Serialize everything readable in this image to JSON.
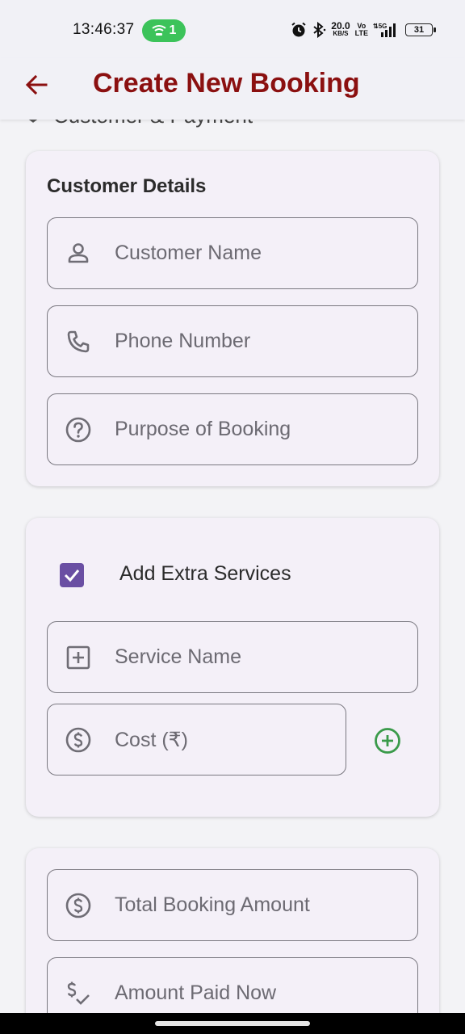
{
  "status_bar": {
    "time": "13:46:37",
    "hotspot_count": "1",
    "net_speed_value": "20.0",
    "net_speed_unit": "KB/S",
    "volte_top": "Vo",
    "volte_bottom": "LTE",
    "network": "5G",
    "battery": "31"
  },
  "app_bar": {
    "title": "Create New Booking",
    "back_icon": "arrow-left-icon",
    "title_color": "#8b1010"
  },
  "partial_section_heading": "Customer & Payment",
  "customer_card": {
    "title": "Customer Details",
    "fields": [
      {
        "icon": "person-icon",
        "placeholder": "Customer Name"
      },
      {
        "icon": "phone-icon",
        "placeholder": "Phone Number"
      },
      {
        "icon": "help-circle-icon",
        "placeholder": "Purpose of Booking"
      }
    ]
  },
  "extra_services_card": {
    "checkbox_label": "Add Extra Services",
    "checkbox_checked": true,
    "checkbox_color": "#6a4fa3",
    "service_name_placeholder": "Service Name",
    "cost_placeholder": "Cost (₹)",
    "add_icon": "add-circle-icon",
    "add_icon_color": "#3a9a4a"
  },
  "payment_card": {
    "fields": [
      {
        "icon": "dollar-circle-icon",
        "placeholder": "Total Booking Amount"
      },
      {
        "icon": "price-check-icon",
        "placeholder": "Amount Paid Now"
      }
    ]
  }
}
